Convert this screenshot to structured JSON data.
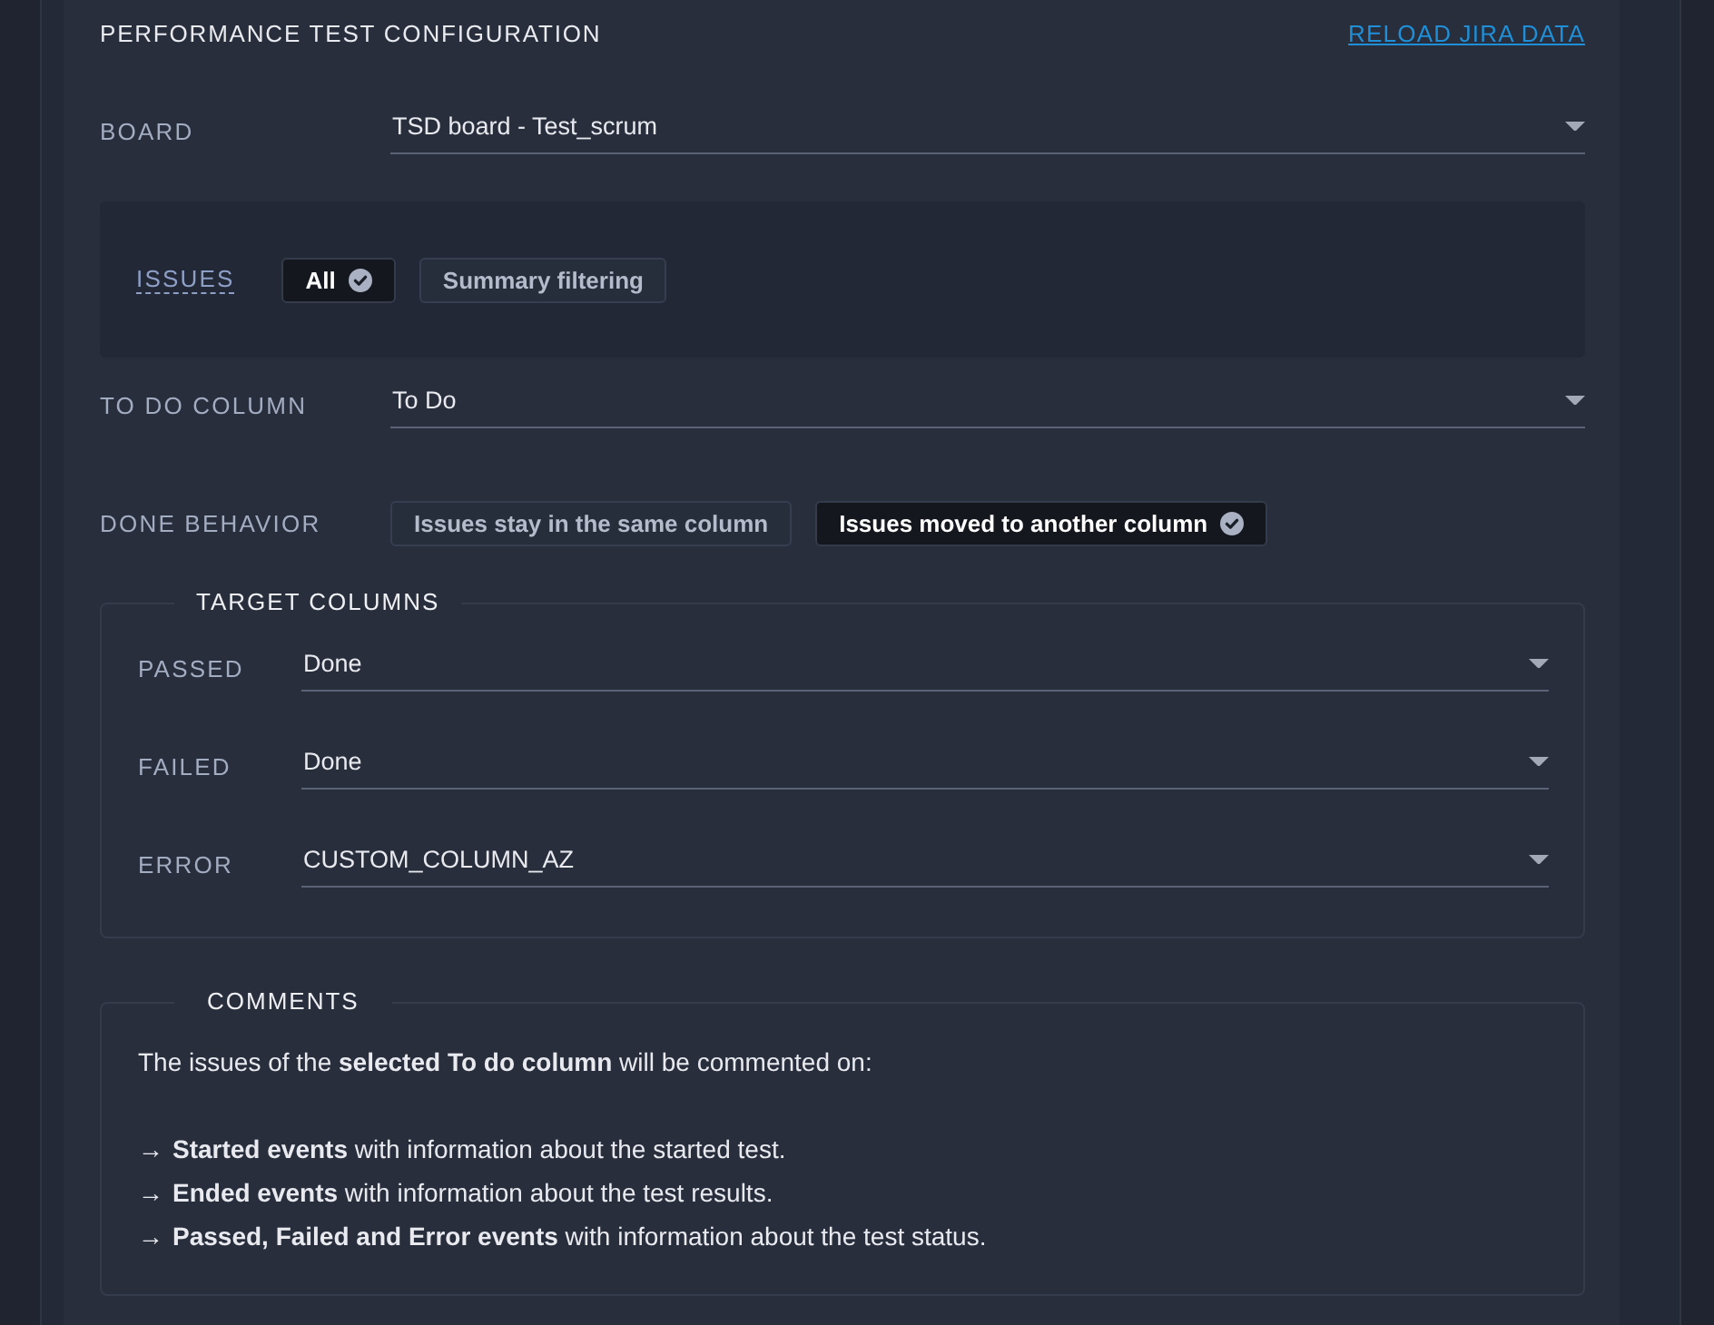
{
  "header": {
    "title": "PERFORMANCE TEST CONFIGURATION",
    "reload_link": "RELOAD JIRA DATA"
  },
  "board": {
    "label": "BOARD",
    "value": "TSD board - Test_scrum"
  },
  "issues": {
    "label": "ISSUES",
    "options": [
      {
        "label": "All",
        "selected": true
      },
      {
        "label": "Summary filtering",
        "selected": false
      }
    ]
  },
  "todo_column": {
    "label": "TO DO COLUMN",
    "value": "To Do"
  },
  "done_behavior": {
    "label": "DONE BEHAVIOR",
    "options": [
      {
        "label": "Issues stay in the same column",
        "selected": false
      },
      {
        "label": "Issues moved to another column",
        "selected": true
      }
    ]
  },
  "target_columns": {
    "legend": "TARGET COLUMNS",
    "rows": [
      {
        "label": "PASSED",
        "value": "Done"
      },
      {
        "label": "FAILED",
        "value": "Done"
      },
      {
        "label": "ERROR",
        "value": "CUSTOM_COLUMN_AZ"
      }
    ]
  },
  "comments": {
    "legend": "COMMENTS",
    "intro": "The issues of the **selected To do column** will be commented on:",
    "items": [
      {
        "arrow": "→",
        "text": "**Started events** with information about the started test."
      },
      {
        "arrow": "→",
        "text": "**Ended events** with information about the test results."
      },
      {
        "arrow": "→",
        "text": "**Passed, Failed and Error events** with information about the test status."
      }
    ]
  }
}
